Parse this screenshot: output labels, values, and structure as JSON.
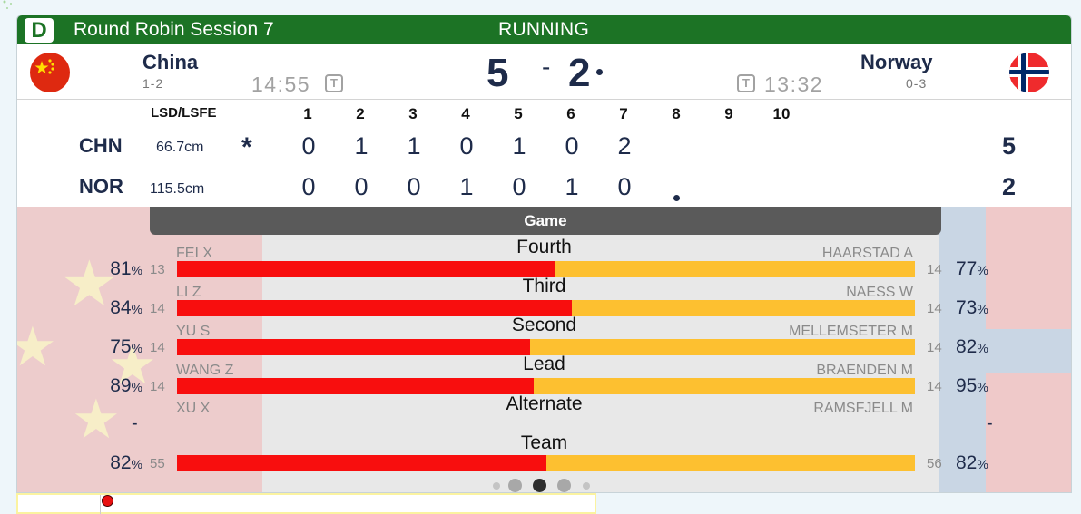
{
  "header": {
    "sheet": "D",
    "session": "Round Robin Session 7",
    "state": "RUNNING"
  },
  "teams": {
    "home": {
      "name": "China",
      "record": "1-2",
      "clock": "14:55",
      "timeout_label": "T",
      "score": "5",
      "flag": "china-flag"
    },
    "away": {
      "name": "Norway",
      "record": "0-3",
      "clock": "13:32",
      "timeout_label": "T",
      "score": "2",
      "flag": "norway-flag"
    },
    "separator": "-"
  },
  "linescore": {
    "lsd_header": "LSD/LSFE",
    "ends": [
      "1",
      "2",
      "3",
      "4",
      "5",
      "6",
      "7",
      "8",
      "9",
      "10"
    ],
    "rows": [
      {
        "code": "CHN",
        "lsd": "66.7cm",
        "marker": "*",
        "ends": [
          "0",
          "1",
          "1",
          "0",
          "1",
          "0",
          "2",
          "",
          "",
          ""
        ],
        "total": "5"
      },
      {
        "code": "NOR",
        "lsd": "115.5cm",
        "marker": "",
        "ends": [
          "0",
          "0",
          "0",
          "1",
          "0",
          "1",
          "0",
          "",
          "",
          ""
        ],
        "total": "2"
      }
    ]
  },
  "stats": {
    "tab": "Game",
    "rows": [
      {
        "position": "Fourth",
        "left_name": "FEI X",
        "right_name": "HAARSTAD A",
        "left_pct": "81",
        "right_pct": "77",
        "left_shots": "13",
        "right_shots": "14",
        "left_share": 0.513
      },
      {
        "position": "Third",
        "left_name": "LI Z",
        "right_name": "NAESS W",
        "left_pct": "84",
        "right_pct": "73",
        "left_shots": "14",
        "right_shots": "14",
        "left_share": 0.535
      },
      {
        "position": "Second",
        "left_name": "YU S",
        "right_name": "MELLEMSETER M",
        "left_pct": "75",
        "right_pct": "82",
        "left_shots": "14",
        "right_shots": "14",
        "left_share": 0.478
      },
      {
        "position": "Lead",
        "left_name": "WANG Z",
        "right_name": "BRAENDEN M",
        "left_pct": "89",
        "right_pct": "95",
        "left_shots": "14",
        "right_shots": "14",
        "left_share": 0.484
      },
      {
        "position": "Alternate",
        "left_name": "XU X",
        "right_name": "RAMSFJELL M",
        "left_pct": "-",
        "right_pct": "-",
        "left_shots": "",
        "right_shots": "",
        "left_share": null
      },
      {
        "position": "Team",
        "left_name": "",
        "right_name": "",
        "left_pct": "82",
        "right_pct": "82",
        "left_shots": "55",
        "right_shots": "56",
        "left_share": 0.5
      }
    ],
    "percent_symbol": "%"
  },
  "pager": {
    "pages": 5,
    "active": 2
  },
  "colors": {
    "header_green": "#1c7325",
    "home_bar": "#f80e0e",
    "away_bar": "#fdc030",
    "text_navy": "#1e2b4a"
  }
}
